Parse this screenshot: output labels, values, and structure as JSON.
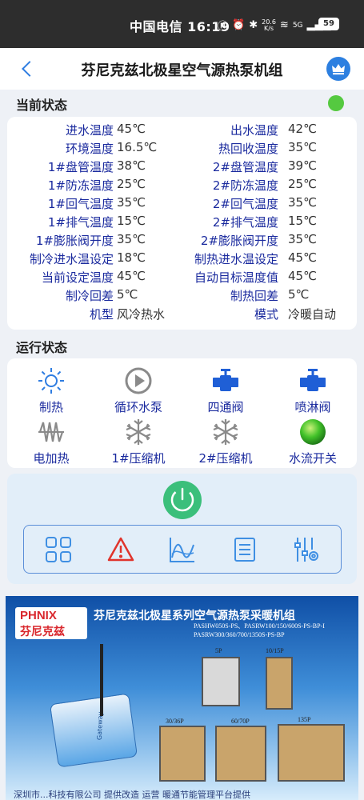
{
  "status_bar": {
    "carrier": "中国电信",
    "time": "16:19",
    "speed_value": "20.6",
    "speed_unit": "K/s",
    "network": "5G",
    "battery": "59"
  },
  "header": {
    "title": "芬尼克兹北极星空气源热泵机组",
    "back_icon": "chevron-left-icon",
    "crown_icon": "crown-icon"
  },
  "current_status": {
    "label": "当前状态",
    "online_color": "#55c940",
    "rows": [
      {
        "l1": "进水温度",
        "v1": "45℃",
        "l2": "出水温度",
        "v2": "42℃"
      },
      {
        "l1": "环境温度",
        "v1": "16.5℃",
        "l2": "热回收温度",
        "v2": "35℃"
      },
      {
        "l1": "1#盘管温度",
        "v1": "38℃",
        "l2": "2#盘管温度",
        "v2": "39℃"
      },
      {
        "l1": "1#防冻温度",
        "v1": "25℃",
        "l2": "2#防冻温度",
        "v2": "25℃"
      },
      {
        "l1": "1#回气温度",
        "v1": "35℃",
        "l2": "2#回气温度",
        "v2": "35℃"
      },
      {
        "l1": "1#排气温度",
        "v1": "15℃",
        "l2": "2#排气温度",
        "v2": "15℃"
      },
      {
        "l1": "1#膨胀阀开度",
        "v1": "35℃",
        "l2": "2#膨胀阀开度",
        "v2": "35℃"
      },
      {
        "l1": "制冷进水温设定",
        "v1": "18℃",
        "l2": "制热进水温设定",
        "v2": "45℃"
      },
      {
        "l1": "当前设定温度",
        "v1": "45℃",
        "l2": "自动目标温度值",
        "v2": "45℃"
      },
      {
        "l1": "制冷回差",
        "v1": "5℃",
        "l2": "制热回差",
        "v2": "5℃"
      },
      {
        "l1": "机型",
        "v1": "风冷热水",
        "l2": "模式",
        "v2": "冷暖自动"
      }
    ]
  },
  "run_status": {
    "label": "运行状态",
    "items": [
      {
        "label": "制热",
        "icon": "sun-icon"
      },
      {
        "label": "循环水泵",
        "icon": "pump-play-icon"
      },
      {
        "label": "四通阀",
        "icon": "valve-icon"
      },
      {
        "label": "喷淋阀",
        "icon": "spray-valve-icon"
      },
      {
        "label": "电加热",
        "icon": "heater-icon"
      },
      {
        "label": "1#压缩机",
        "icon": "snowflake-icon"
      },
      {
        "label": "2#压缩机",
        "icon": "snowflake-icon"
      },
      {
        "label": "水流开关",
        "icon": "water-flow-ball-icon"
      }
    ]
  },
  "controls": {
    "power_icon": "power-icon",
    "tools": [
      "grid-icon",
      "alarm-icon",
      "chart-icon",
      "list-icon",
      "settings-sliders-icon"
    ]
  },
  "banner": {
    "logo_en": "PHNIX",
    "logo_cn": "芬尼克兹",
    "title": "芬尼克兹北极星系列空气源热泵采暖机组",
    "models_line1": "PASHW050S-PS、PASRW100/150/600S-PS-BP-I",
    "models_line2": "PASRW300/360/700/1350S-PS-BP",
    "labels": [
      "5P",
      "10/15P",
      "30/36P",
      "60/70P",
      "135P"
    ],
    "device_brand": "Gateway",
    "footer": "深圳市...科技有限公司   提供改造  运营  暖通节能管理平台提供"
  }
}
